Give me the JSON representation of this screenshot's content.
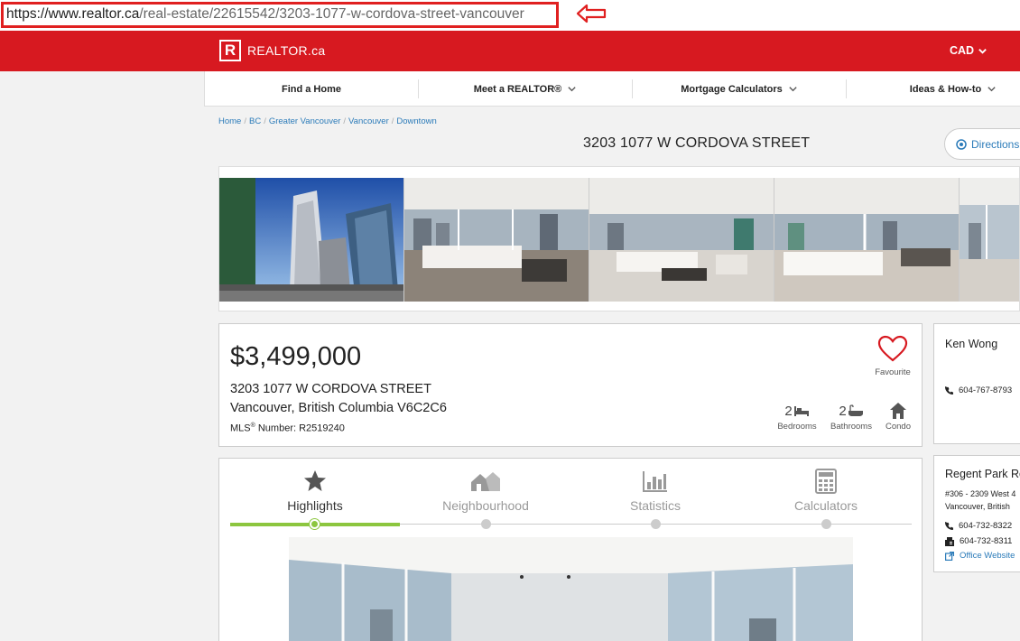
{
  "url": {
    "domain": "https://www.realtor.ca",
    "path": "/real-estate/22615542/3203-1077-w-cordova-street-vancouver",
    "highlight_color": "#e02020"
  },
  "header": {
    "brand": "REALTOR.ca",
    "logo_letter": "R",
    "currency": "CAD",
    "color": "#d71920"
  },
  "nav": {
    "items": [
      {
        "label": "Find a Home",
        "has_dropdown": false
      },
      {
        "label": "Meet a REALTOR®",
        "has_dropdown": true
      },
      {
        "label": "Mortgage Calculators",
        "has_dropdown": true
      },
      {
        "label": "Ideas & How-to",
        "has_dropdown": true
      }
    ]
  },
  "breadcrumb": [
    "Home",
    "BC",
    "Greater Vancouver",
    "Vancouver",
    "Downtown"
  ],
  "listing": {
    "title": "3203 1077 W CORDOVA STREET",
    "directions_label": "Directions",
    "price": "$3,499,000",
    "address_line1": "3203 1077 W CORDOVA STREET",
    "address_line2": "Vancouver, British Columbia V6C2C6",
    "mls_prefix": "MLS",
    "mls_sup": "®",
    "mls_label": " Number: R2519240",
    "favourite_label": "Favourite",
    "bedrooms_count": "2",
    "bedrooms_label": "Bedrooms",
    "bathrooms_count": "2",
    "bathrooms_label": "Bathrooms",
    "type_label": "Condo"
  },
  "tabs": [
    {
      "label": "Highlights",
      "icon": "star-icon",
      "active": true
    },
    {
      "label": "Neighbourhood",
      "icon": "neighbourhood-icon",
      "active": false
    },
    {
      "label": "Statistics",
      "icon": "bar-chart-icon",
      "active": false
    },
    {
      "label": "Calculators",
      "icon": "calculator-icon",
      "active": false
    }
  ],
  "agent": {
    "name": "Ken Wong",
    "phone": "604-767-8793"
  },
  "office": {
    "name": "Regent Park Re",
    "address1": "#306 - 2309 West 4",
    "address2": "Vancouver, British",
    "phone": "604-732-8322",
    "fax": "604-732-8311",
    "website_label": "Office Website"
  },
  "accent": "#8cc63f"
}
